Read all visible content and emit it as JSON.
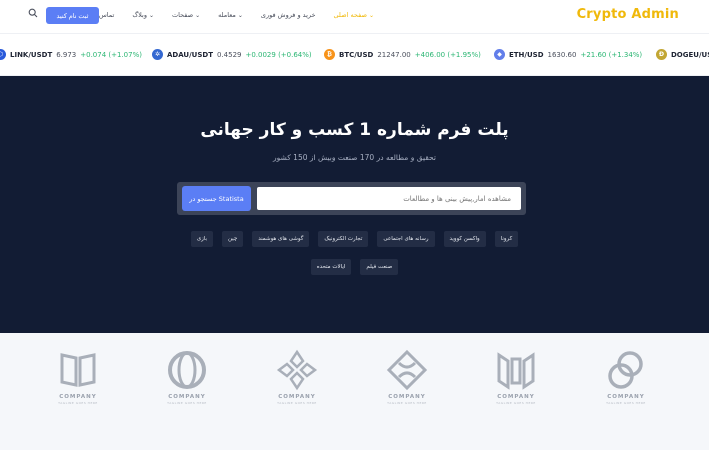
{
  "header": {
    "brand": "Crypto Admin",
    "signup_label": "ثبت نام کنید",
    "nav": [
      {
        "label": "صفحه اصلی",
        "active": true,
        "has_menu": true
      },
      {
        "label": "خرید و فروش فوری",
        "active": false,
        "has_menu": false
      },
      {
        "label": "معامله",
        "active": false,
        "has_menu": true
      },
      {
        "label": "صفحات",
        "active": false,
        "has_menu": true
      },
      {
        "label": "وبلاگ",
        "active": false,
        "has_menu": true
      },
      {
        "label": "تماس با ما",
        "active": false,
        "has_menu": false
      }
    ]
  },
  "ticker": [
    {
      "symbol": "LINK/USDT",
      "price": "6.973",
      "change": "+0.074 (+1.07%)",
      "icon": "link-coin-icon",
      "color": "#2a5ada"
    },
    {
      "symbol": "ADAU/USDT",
      "price": "0.4529",
      "change": "+0.0029 (+0.64%)",
      "icon": "ada-coin-icon",
      "color": "#3468d1"
    },
    {
      "symbol": "BTC/USD",
      "price": "21247.00",
      "change": "+406.00 (+1.95%)",
      "icon": "btc-coin-icon",
      "color": "#f7931a"
    },
    {
      "symbol": "ETH/USD",
      "price": "1630.60",
      "change": "+21.60 (+1.34%)",
      "icon": "eth-coin-icon",
      "color": "#627eea"
    },
    {
      "symbol": "DOGEU/US",
      "price": "",
      "change": "",
      "icon": "doge-coin-icon",
      "color": "#c2a633"
    }
  ],
  "hero": {
    "title": "پلت فرم شماره 1 کسب و کار جهانی",
    "subtitle": "تحقیق و مطالعه در 170 صنعت وبیش از 150 کشور",
    "search_placeholder": "مشاهده امار,پیش بینی ها و مطالعات",
    "search_button": "جستجو در Statista",
    "chips_row1": [
      "کرونا",
      "واکسن کووید",
      "رسانه های اجتماعی",
      "تجارت الکترونیک",
      "گوشی های هوشمند",
      "چین",
      "بازی"
    ],
    "chips_row2": [
      "صنعت فیلم",
      "ایالات متحده"
    ]
  },
  "logos": [
    {
      "name": "COMPANY",
      "tagline": "TAGLINE GOES HERE"
    },
    {
      "name": "COMPANY",
      "tagline": "TAGLINE GOES HERE"
    },
    {
      "name": "COMPANY",
      "tagline": "TAGLINE GOES HERE"
    },
    {
      "name": "COMPANY",
      "tagline": "TAGLINE GOES HERE"
    },
    {
      "name": "COMPANY",
      "tagline": "TAGLINE GOES HERE"
    },
    {
      "name": "COMPANY",
      "tagline": "TAGLINE GOES HERE"
    }
  ],
  "colors": {
    "accent": "#5b7ef5",
    "brand": "#f0b90b",
    "hero_bg": "#121c34",
    "positive": "#2bb673"
  }
}
